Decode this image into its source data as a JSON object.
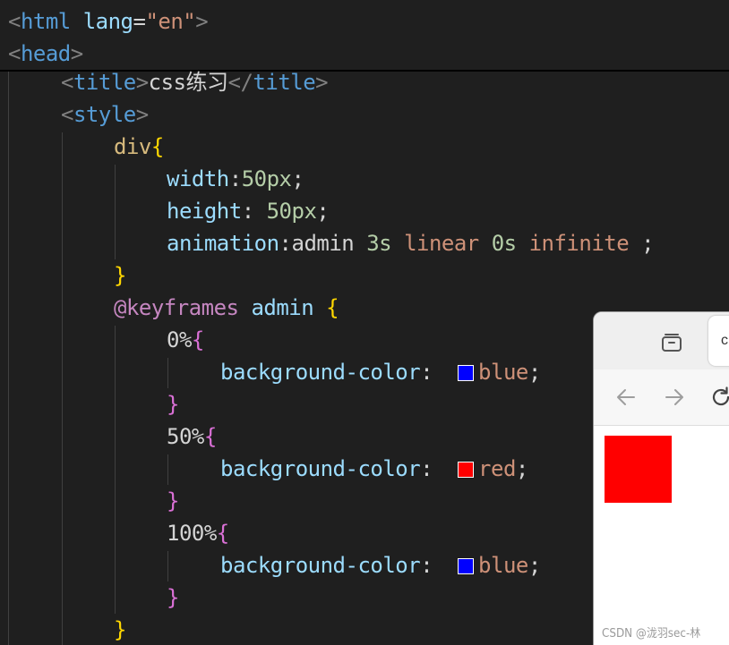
{
  "editor": {
    "lines": {
      "html_open": {
        "bracket_open": "<",
        "tag": "html",
        "attr": "lang",
        "eq": "=",
        "value": "\"en\"",
        "bracket_close": ">"
      },
      "head_open": {
        "bracket_open": "<",
        "tag": "head",
        "bracket_close": ">"
      },
      "title": {
        "open_lt": "<",
        "open_tag": "title",
        "open_gt": ">",
        "text": "css练习",
        "close_lt": "</",
        "close_tag": "title",
        "close_gt": ">"
      },
      "style_open": {
        "bracket_open": "<",
        "tag": "style",
        "bracket_close": ">"
      },
      "div_selector": {
        "selector": "div",
        "brace": "{"
      },
      "width": {
        "prop": "width",
        "colon": ":",
        "value": "50px",
        "semi": ";"
      },
      "height": {
        "prop": "height",
        "colon": ": ",
        "value": "50px",
        "semi": ";"
      },
      "animation": {
        "prop": "animation",
        "colon": ":",
        "name": "admin",
        "duration": "3s",
        "timing": "linear",
        "delay": "0s",
        "iteration": "infinite",
        "semi": ";"
      },
      "div_close": {
        "brace": "}"
      },
      "keyframes": {
        "keyword": "@keyframes",
        "name": "admin",
        "brace": "{"
      },
      "kf0_open": {
        "percent": "0%",
        "brace": "{"
      },
      "kf0_bg": {
        "prop": "background-color",
        "colon": ":",
        "value": "blue",
        "semi": ";",
        "swatch": "#0000ff"
      },
      "kf0_close": {
        "brace": "}"
      },
      "kf50_open": {
        "percent": "50%",
        "brace": "{"
      },
      "kf50_bg": {
        "prop": "background-color",
        "colon": ":",
        "value": "red",
        "semi": ";",
        "swatch": "#ff0000"
      },
      "kf50_close": {
        "brace": "}"
      },
      "kf100_open": {
        "percent": "100%",
        "brace": "{"
      },
      "kf100_bg": {
        "prop": "background-color",
        "colon": ":",
        "value": "blue",
        "semi": ";",
        "swatch": "#0000ff"
      },
      "kf100_close": {
        "brace": "}"
      },
      "keyframes_close": {
        "brace": "}"
      }
    }
  },
  "browser": {
    "tab_label": "c",
    "box_color": "#ff0000",
    "icons": [
      "tab-overview-icon",
      "back-arrow-icon",
      "forward-arrow-icon",
      "reload-icon"
    ]
  },
  "watermark": "CSDN @泷羽sec-林",
  "colors": {
    "editor_bg": "#1f1f1f",
    "tag": "#569cd6",
    "attr": "#9cdcfe",
    "string": "#ce9178",
    "selector": "#d7ba7d",
    "number": "#b5cea8",
    "keyword": "#c586c0",
    "brace_gold": "#ffd700",
    "brace_purple": "#da70d6"
  }
}
